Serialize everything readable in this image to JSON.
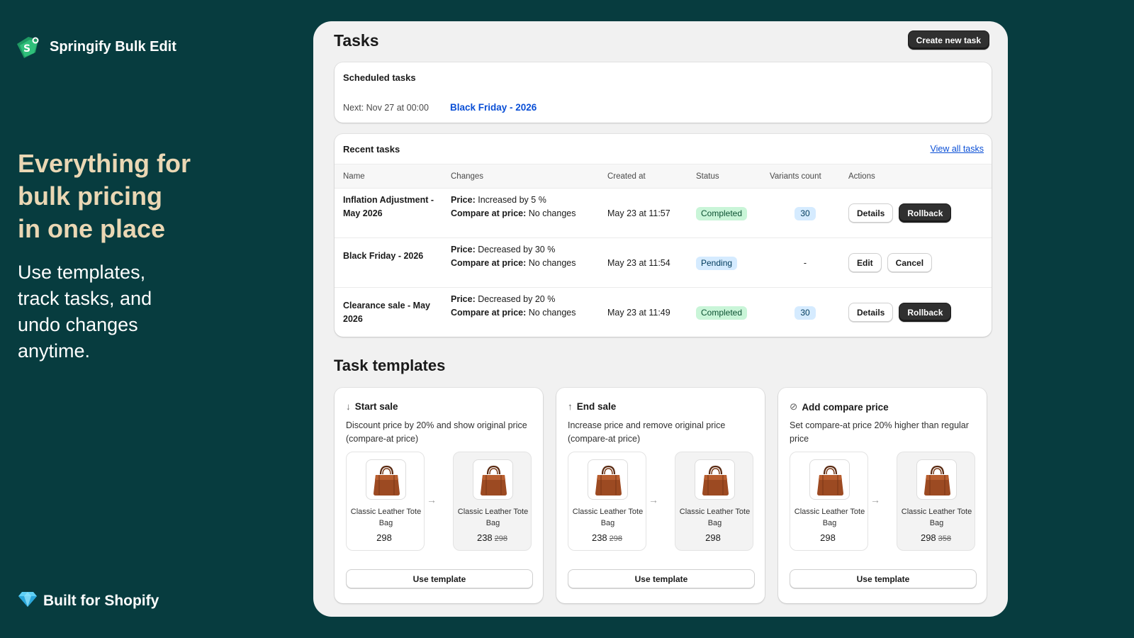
{
  "brand": {
    "name": "Springify Bulk Edit"
  },
  "promo": {
    "headline_lines": [
      "Everything for",
      "bulk pricing",
      "in one place"
    ],
    "sub_lines": [
      "Use templates,",
      "track tasks, and",
      "undo changes",
      "anytime."
    ],
    "built_for": "Built for Shopify"
  },
  "page": {
    "title": "Tasks",
    "create_button": "Create new task"
  },
  "scheduled": {
    "title": "Scheduled tasks",
    "next_label": "Next: Nov 27 at 00:00",
    "next_task": "Black Friday - 2026"
  },
  "recent": {
    "title": "Recent tasks",
    "view_all": "View all tasks",
    "columns": [
      "Name",
      "Changes",
      "Created at",
      "Status",
      "Variants count",
      "Actions"
    ],
    "rows": [
      {
        "name": "Inflation Adjustment - May 2026",
        "price_label": "Price:",
        "price_change": "Increased by 5 %",
        "compare_label": "Compare at price:",
        "compare_change": "No changes",
        "created": "May 23 at 11:57",
        "status": "Completed",
        "variants": "30",
        "actions": [
          "Details",
          "Rollback"
        ]
      },
      {
        "name": "Black Friday - 2026",
        "price_label": "Price:",
        "price_change": "Decreased by 30 %",
        "compare_label": "Compare at price:",
        "compare_change": "No changes",
        "created": "May 23 at 11:54",
        "status": "Pending",
        "variants": "-",
        "actions": [
          "Edit",
          "Cancel"
        ]
      },
      {
        "name": "Clearance sale - May 2026",
        "price_label": "Price:",
        "price_change": "Decreased by 20 %",
        "compare_label": "Compare at price:",
        "compare_change": "No changes",
        "created": "May 23 at 11:49",
        "status": "Completed",
        "variants": "30",
        "actions": [
          "Details",
          "Rollback"
        ]
      }
    ]
  },
  "templates": {
    "title": "Task templates",
    "cards": [
      {
        "icon": "arrow-down-icon",
        "glyph": "↓",
        "title": "Start sale",
        "description": "Discount price by 20% and show original price (compare-at price)",
        "before": {
          "name": "Classic Leather Tote Bag",
          "price": "298",
          "compare": ""
        },
        "after": {
          "name": "Classic Leather Tote Bag",
          "price": "238",
          "compare": "298"
        },
        "button": "Use template"
      },
      {
        "icon": "arrow-up-icon",
        "glyph": "↑",
        "title": "End sale",
        "description": "Increase price and remove original price (compare-at price)",
        "before": {
          "name": "Classic Leather Tote Bag",
          "price": "238",
          "compare": "298"
        },
        "after": {
          "name": "Classic Leather Tote Bag",
          "price": "298",
          "compare": ""
        },
        "button": "Use template"
      },
      {
        "icon": "compare-price-icon",
        "glyph": "⊘",
        "title": "Add compare price",
        "description": "Set compare-at price 20% higher than regular price",
        "before": {
          "name": "Classic Leather Tote Bag",
          "price": "298",
          "compare": ""
        },
        "after": {
          "name": "Classic Leather Tote Bag",
          "price": "298",
          "compare": "358"
        },
        "button": "Use template"
      }
    ]
  },
  "colors": {
    "background": "#073c3f",
    "headline": "#ead7b4",
    "link": "#0a4fd6",
    "completed_badge": "#c9f5d8",
    "pending_badge": "#d5ebff",
    "primary_button": "#303030"
  }
}
